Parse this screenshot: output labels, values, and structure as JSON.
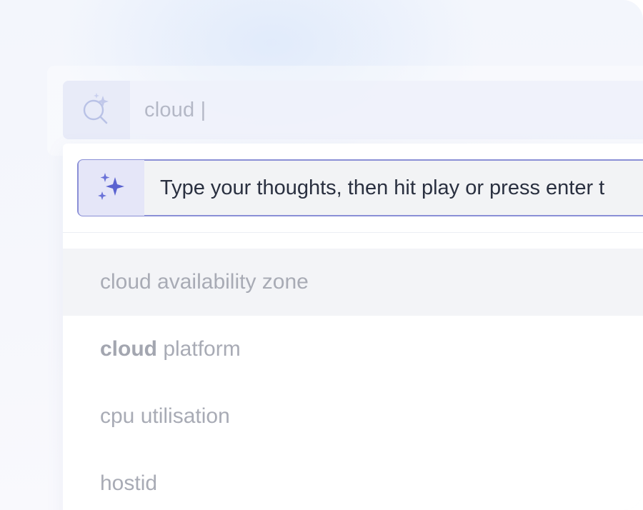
{
  "search": {
    "value": "cloud |",
    "icon": "ai-search-icon"
  },
  "prompt": {
    "text": "Type your thoughts, then hit play or press enter t",
    "icon": "sparkles-icon",
    "accent_color": "#8a8fd6"
  },
  "suggestions": [
    {
      "bold": "",
      "text": "cloud availability zone",
      "highlighted": true
    },
    {
      "bold": "cloud",
      "text": " platform",
      "highlighted": false
    },
    {
      "bold": "",
      "text": "cpu utilisation",
      "highlighted": false
    },
    {
      "bold": "",
      "text": "hostid",
      "highlighted": false
    }
  ]
}
